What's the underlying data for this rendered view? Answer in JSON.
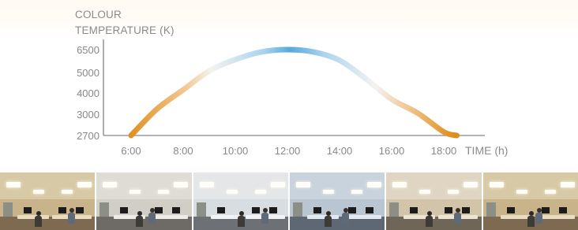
{
  "y_axis_title": [
    "COLOUR",
    "TEMPERATURE (K)"
  ],
  "x_axis_title": "TIME (h)",
  "chart_data": {
    "type": "line",
    "title": "",
    "ylabel": "COLOUR TEMPERATURE (K)",
    "xlabel": "TIME (h)",
    "y_ticks": [
      "6500",
      "5000",
      "4000",
      "3000",
      "2700"
    ],
    "x_ticks": [
      "6:00",
      "8:00",
      "10:00",
      "12:00",
      "14:00",
      "16:00",
      "18:00"
    ],
    "series": [
      {
        "values": [
          {
            "x": 6,
            "y": 2700
          },
          {
            "x": 7,
            "y": 3250
          },
          {
            "x": 8,
            "y": 4150
          },
          {
            "x": 9,
            "y": 5100
          },
          {
            "x": 10,
            "y": 5850
          },
          {
            "x": 11,
            "y": 6350
          },
          {
            "x": 12,
            "y": 6500
          },
          {
            "x": 13,
            "y": 6350
          },
          {
            "x": 14,
            "y": 5800
          },
          {
            "x": 15,
            "y": 4700
          },
          {
            "x": 16,
            "y": 3700
          },
          {
            "x": 17,
            "y": 3050
          },
          {
            "x": 18,
            "y": 2750
          },
          {
            "x": 18.5,
            "y": 2700
          }
        ]
      }
    ],
    "colors": {
      "warm": "#e08c1a",
      "neutral": "#f4f3f0",
      "cool": "#56a9dc",
      "axis": "#9b9b9b",
      "tick_text": "#888888"
    }
  },
  "photos": [
    {
      "tone": "warm"
    },
    {
      "tone": "neutral"
    },
    {
      "tone": "cool-light"
    },
    {
      "tone": "cool"
    },
    {
      "tone": "neutral-warm"
    },
    {
      "tone": "warm"
    }
  ]
}
